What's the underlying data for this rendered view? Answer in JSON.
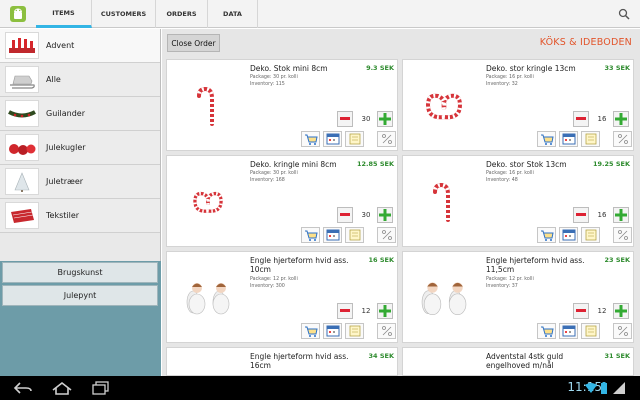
{
  "topbar": {
    "tabs": [
      {
        "label": "ITEMS",
        "active": true
      },
      {
        "label": "CUSTOMERS",
        "active": false
      },
      {
        "label": "ORDERS",
        "active": false
      },
      {
        "label": "DATA",
        "active": false
      }
    ]
  },
  "sidebar": {
    "categories": [
      {
        "label": "Advent",
        "icon": "advent-thumb-icon"
      },
      {
        "label": "Alle",
        "icon": "sleigh-thumb-icon"
      },
      {
        "label": "Guilander",
        "icon": "garland-thumb-icon"
      },
      {
        "label": "Julekugler",
        "icon": "baubles-thumb-icon"
      },
      {
        "label": "Juletræer",
        "icon": "tree-thumb-icon"
      },
      {
        "label": "Tekstiler",
        "icon": "textile-thumb-icon"
      }
    ],
    "groups": [
      {
        "label": "Brugskunst"
      },
      {
        "label": "Julepynt"
      }
    ]
  },
  "header": {
    "close_order": "Close Order",
    "shop_name": "KÖKS & IDEBODEN"
  },
  "products": [
    {
      "name": "Deko. Stok mini 8cm",
      "price": "9.3 SEK",
      "package": "Package: 30 pr. kolli",
      "inventory": "Inventory: 115",
      "qty": "30",
      "image": "candy-cane-icon"
    },
    {
      "name": "Deko. stor kringle 13cm",
      "price": "33 SEK",
      "package": "Package: 16 pr. kolli",
      "inventory": "Inventory: 32",
      "qty": "16",
      "image": "pretzel-icon"
    },
    {
      "name": "Deko. kringle mini 8cm",
      "price": "12.85 SEK",
      "package": "Package: 30 pr. kolli",
      "inventory": "Inventory: 168",
      "qty": "30",
      "image": "pretzel-icon"
    },
    {
      "name": "Deko. stor Stok 13cm",
      "price": "19.25 SEK",
      "package": "Package: 16 pr. kolli",
      "inventory": "Inventory: 48",
      "qty": "16",
      "image": "candy-cane-icon"
    },
    {
      "name": "Engle hjerteform hvid ass. 10cm",
      "price": "16 SEK",
      "package": "Package: 12 pr. kolli",
      "inventory": "Inventory: 300",
      "qty": "12",
      "image": "angels-icon"
    },
    {
      "name": "Engle hjerteform hvid ass. 11,5cm",
      "price": "23 SEK",
      "package": "Package: 12 pr. kolli",
      "inventory": "Inventory: 37",
      "qty": "12",
      "image": "angels-icon"
    },
    {
      "name": "Engle hjerteform hvid ass. 16cm",
      "price": "34 SEK",
      "package": "",
      "inventory": "",
      "qty": "",
      "image": ""
    },
    {
      "name": "Adventstal 4stk guld engelhoved m/nål",
      "price": "31 SEK",
      "package": "",
      "inventory": "",
      "qty": "",
      "image": ""
    }
  ],
  "system": {
    "clock": "11:15"
  },
  "colors": {
    "accent": "#33b5e5",
    "price": "#2e8b2e",
    "shop_name": "#e2542a",
    "sidebar_lower": "#6d9ca8"
  }
}
